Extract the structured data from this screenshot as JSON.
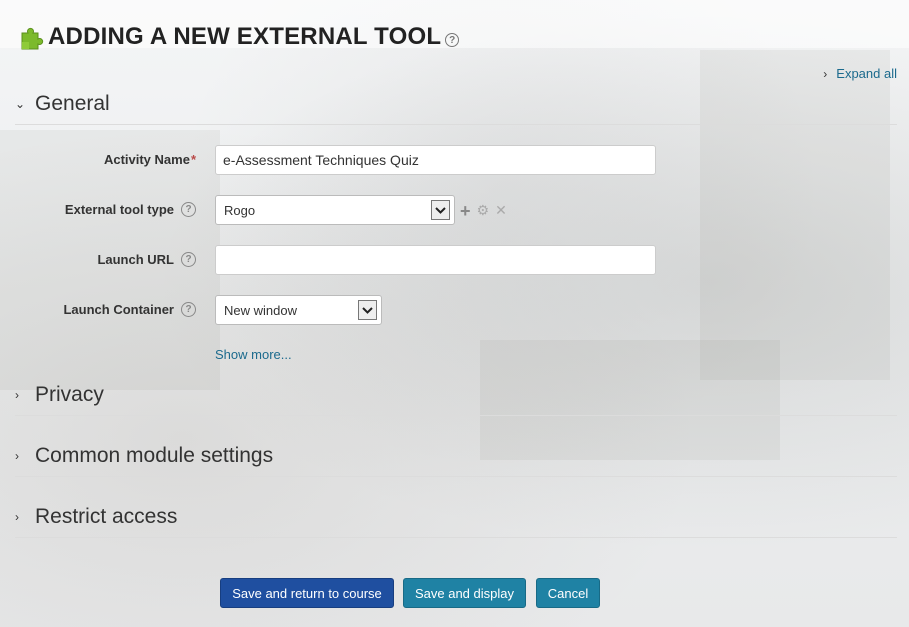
{
  "header": {
    "title": "ADDING A NEW EXTERNAL TOOL",
    "help_glyph": "?",
    "icon": "puzzle-icon",
    "icon_color": "#7cba2c"
  },
  "expand_all_label": "Expand all",
  "sections": {
    "general": "General",
    "privacy": "Privacy",
    "common": "Common module settings",
    "restrict": "Restrict access"
  },
  "form": {
    "activity_name_label": "Activity Name",
    "required_mark": "*",
    "activity_name_value": "e-Assessment Techniques Quiz",
    "tool_type_label": "External tool type",
    "tool_type_value": "Rogo",
    "launch_url_label": "Launch URL",
    "launch_url_value": "",
    "launch_container_label": "Launch Container",
    "launch_container_value": "New window",
    "show_more_label": "Show more...",
    "help_glyph": "?"
  },
  "buttons": {
    "save_return": "Save and return to course",
    "save_display": "Save and display",
    "cancel": "Cancel"
  },
  "colors": {
    "link": "#1b6a8d",
    "primary_button": "#1f4fa0",
    "secondary_button": "#1f82a4",
    "required": "#b94a48"
  }
}
